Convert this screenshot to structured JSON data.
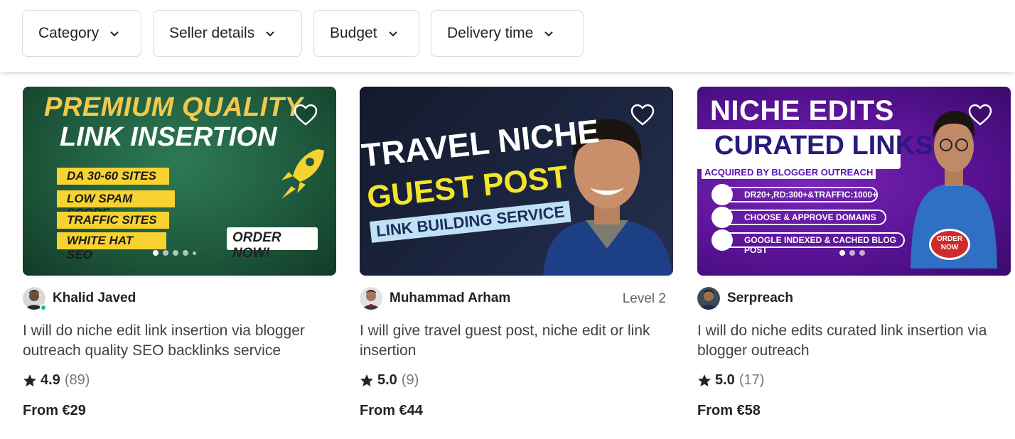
{
  "filters": [
    {
      "label": "Category"
    },
    {
      "label": "Seller details"
    },
    {
      "label": "Budget"
    },
    {
      "label": "Delivery time"
    }
  ],
  "gigs": [
    {
      "thumbnail": {
        "line1": "PREMIUM QUALITY",
        "line2": "LINK INSERTION",
        "bullets": [
          "DA 30-60 SITES",
          "LOW SPAM SCORE",
          "TRAFFIC SITES",
          "WHITE HAT SEO"
        ],
        "cta": "ORDER NOW!"
      },
      "seller": "Khalid Javed",
      "level": "",
      "online": true,
      "title": "I will do niche edit link insertion via blogger outreach quality SEO backlinks service",
      "rating": "4.9",
      "reviews": "(89)",
      "price": "From €29"
    },
    {
      "thumbnail": {
        "line1": "TRAVEL NICHE",
        "line2": "GUEST POST",
        "line3": "LINK BUILDING SERVICE"
      },
      "seller": "Muhammad Arham",
      "level": "Level 2",
      "online": false,
      "title": "I will give travel guest post, niche edit or link insertion",
      "rating": "5.0",
      "reviews": "(9)",
      "price": "From €44"
    },
    {
      "thumbnail": {
        "line1": "NICHE EDITS",
        "line2": "CURATED LINKS",
        "sub": "ACQUIRED BY BLOGGER OUTREACH",
        "rows": [
          "DR20+,RD:300+&TRAFFIC:1000+",
          "CHOOSE & APPROVE DOMAINS",
          "GOOGLE INDEXED & CACHED BLOG POST"
        ],
        "cta": "ORDER NOW"
      },
      "seller": "Serpreach",
      "level": "",
      "online": false,
      "title": "I will do niche edits curated link insertion via blogger outreach",
      "rating": "5.0",
      "reviews": "(17)",
      "price": "From €58"
    }
  ],
  "colors": {
    "online": "#1dbf73",
    "text": "#222325",
    "muted": "#74767e"
  },
  "icons": {
    "filter_chevron": "chevron-down-icon",
    "favorite": "heart-icon",
    "rating": "star-icon"
  }
}
